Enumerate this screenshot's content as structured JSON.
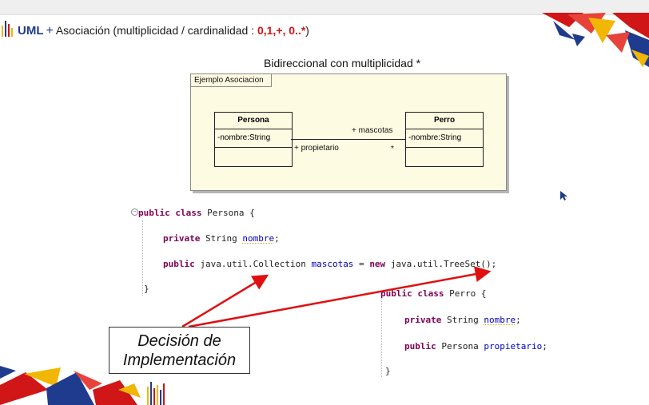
{
  "header": {
    "uml_label": "UML",
    "plus": "+",
    "title": "Asociación  (multiplicidad / cardinalidad : ",
    "multiplicities": "0,1,+, 0..*",
    "close_paren": ")"
  },
  "diagram": {
    "title": "Bidireccional con multiplicidad *",
    "frame_label": "Ejemplo Asociacion",
    "classes": [
      {
        "name": "Persona",
        "attribute": "-nombre:String"
      },
      {
        "name": "Perro",
        "attribute": "-nombre:String"
      }
    ],
    "roles": {
      "left_role": "+ propietario",
      "right_role": "+ mascotas",
      "right_multiplicity": "*"
    }
  },
  "code_persona": {
    "line1": {
      "kw": "public class",
      "rest": " Persona {"
    },
    "line2": {
      "kw": "private",
      "type": " String ",
      "field": "nombre",
      "end": ";"
    },
    "line3": {
      "kw": "public",
      "type": " java.util.Collection ",
      "field": "mascotas",
      "mid": " = ",
      "kw2": "new",
      "end": " java.util.TreeSet();"
    },
    "close": "}"
  },
  "code_perro": {
    "line1": {
      "kw": "public class",
      "rest": " Perro {"
    },
    "line2": {
      "kw": "private",
      "type": " String ",
      "field": "nombre",
      "end": ";"
    },
    "line3": {
      "kw": "public",
      "type": " Persona ",
      "field": "propietario",
      "end": ";"
    },
    "close": "}"
  },
  "callout": {
    "line1": "Decisión de",
    "line2": "Implementación"
  },
  "colors": {
    "uml_blue": "#1f3b8e",
    "multiplicity_red": "#d01616",
    "keyword": "#7f0055",
    "field": "#0000c0",
    "arrow": "#e01010"
  }
}
